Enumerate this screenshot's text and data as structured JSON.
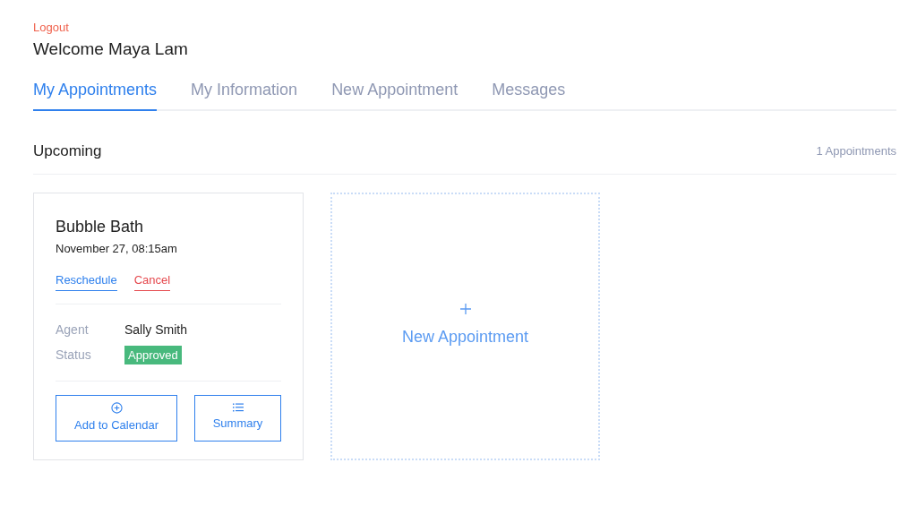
{
  "header": {
    "logout": "Logout",
    "welcome": "Welcome Maya Lam"
  },
  "tabs": [
    {
      "label": "My Appointments",
      "selected": true
    },
    {
      "label": "My Information",
      "selected": false
    },
    {
      "label": "New Appointment",
      "selected": false
    },
    {
      "label": "Messages",
      "selected": false
    }
  ],
  "section": {
    "title": "Upcoming",
    "count": "1 Appointments"
  },
  "appointments": [
    {
      "title": "Bubble Bath",
      "datetime": "November 27, 08:15am",
      "reschedule": "Reschedule",
      "cancel": "Cancel",
      "fields": [
        {
          "label": "Agent",
          "value": "Sally Smith",
          "kind": "text"
        },
        {
          "label": "Status",
          "value": "Approved",
          "kind": "badge"
        }
      ],
      "actions": [
        {
          "label": "Add to Calendar",
          "kind": "add"
        },
        {
          "label": "Summary",
          "kind": "list"
        }
      ]
    }
  ],
  "new_card": {
    "label": "New Appointment"
  }
}
